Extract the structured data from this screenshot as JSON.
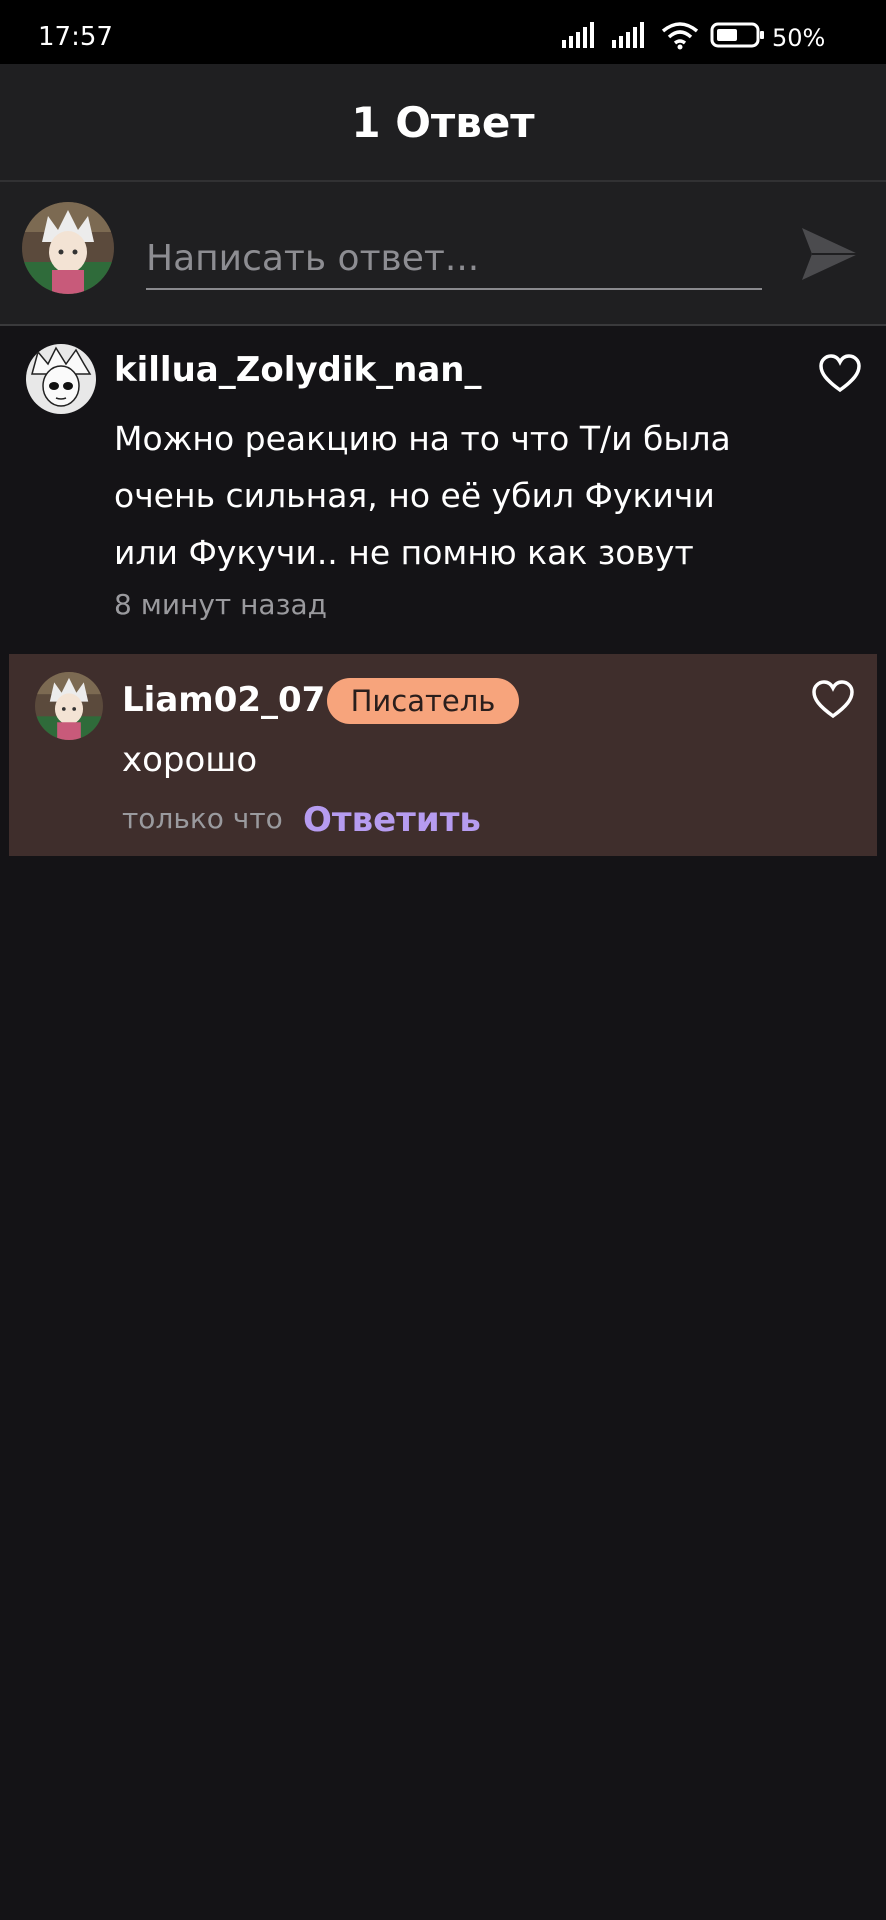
{
  "status_bar": {
    "time": "17:57",
    "battery": "50%",
    "icons": [
      "signal-icon",
      "signal-icon",
      "wifi-icon",
      "battery-icon"
    ]
  },
  "header": {
    "title": "1 Ответ"
  },
  "reply_bar": {
    "placeholder": "Написать ответ...",
    "send_icon": "send-icon"
  },
  "comment": {
    "username": "killua_Zolydik_nan_",
    "text": "Можно реакцию на то что Т/и была очень сильная, но её убил Фукичи или Фукучи.. не помню как зовут",
    "time": "8 минут назад",
    "like_icon": "heart-icon"
  },
  "reply": {
    "username": "Liam02_07",
    "badge": "Писатель",
    "text": "хорошо",
    "time": "только что",
    "reply_label": "Ответить",
    "like_icon": "heart-icon"
  },
  "colors": {
    "background": "#141316",
    "header": "#1f1f21",
    "reply_highlight": "#3f2e2c",
    "badge": "#f7a47c",
    "action": "#b69cf0"
  }
}
